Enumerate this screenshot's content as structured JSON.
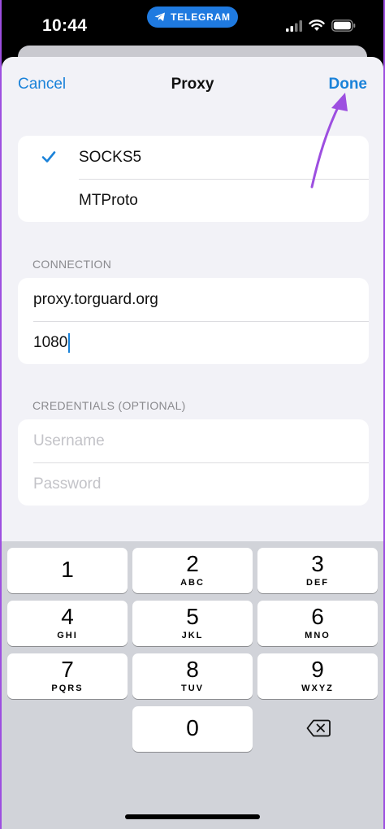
{
  "status_bar": {
    "time": "10:44",
    "app_pill": "TELEGRAM"
  },
  "nav": {
    "cancel": "Cancel",
    "title": "Proxy",
    "done": "Done"
  },
  "proxy_types": {
    "options": [
      "SOCKS5",
      "MTProto"
    ],
    "selected": "SOCKS5"
  },
  "connection": {
    "header": "CONNECTION",
    "server": "proxy.torguard.org",
    "port": "1080"
  },
  "credentials": {
    "header": "CREDENTIALS (OPTIONAL)",
    "username_placeholder": "Username",
    "password_placeholder": "Password"
  },
  "keypad": {
    "keys": [
      {
        "num": "1",
        "letters": ""
      },
      {
        "num": "2",
        "letters": "ABC"
      },
      {
        "num": "3",
        "letters": "DEF"
      },
      {
        "num": "4",
        "letters": "GHI"
      },
      {
        "num": "5",
        "letters": "JKL"
      },
      {
        "num": "6",
        "letters": "MNO"
      },
      {
        "num": "7",
        "letters": "PQRS"
      },
      {
        "num": "8",
        "letters": "TUV"
      },
      {
        "num": "9",
        "letters": "WXYZ"
      },
      {
        "num": "0",
        "letters": ""
      }
    ],
    "backspace_icon": "delete-left-icon"
  },
  "colors": {
    "accent": "#1a82d9",
    "annotation_arrow": "#9d4fe0",
    "telegram_pill": "#1f7ae0"
  }
}
